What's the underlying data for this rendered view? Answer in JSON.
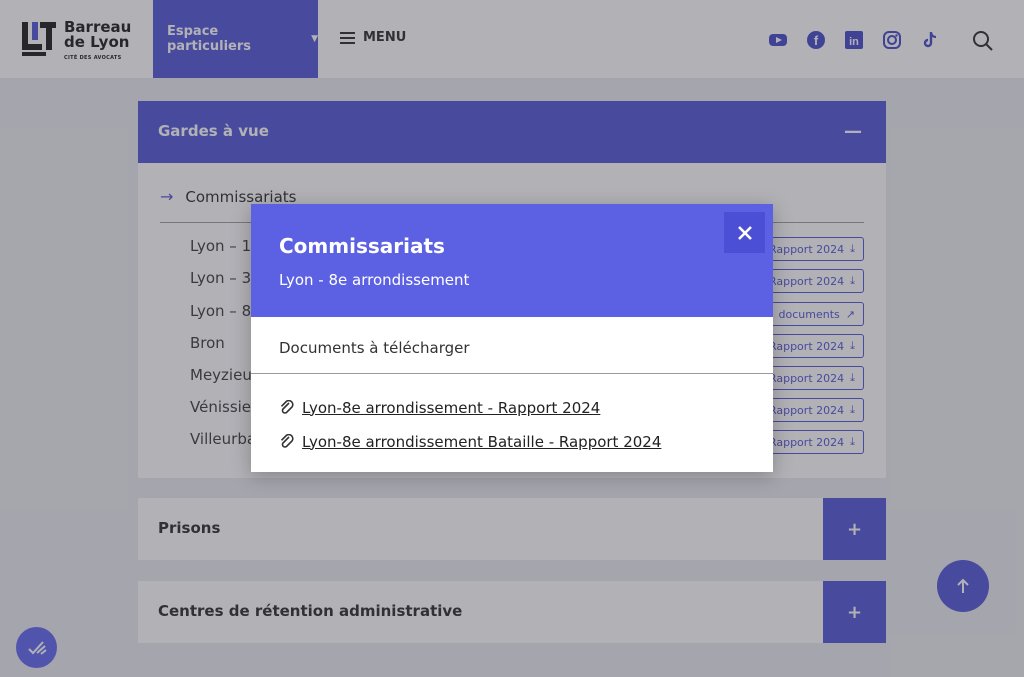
{
  "header": {
    "logo": {
      "line1": "Barreau",
      "line2": "de Lyon",
      "line3": "CITÉ DES AVOCATS"
    },
    "espace_label": "Espace particuliers",
    "menu_label": "MENU",
    "socials": [
      "youtube-icon",
      "facebook-icon",
      "linkedin-icon",
      "instagram-icon",
      "tiktok-icon"
    ]
  },
  "accordion": {
    "open_title": "Gardes à vue",
    "sub_title": "Commissariats",
    "rows": [
      {
        "label": "Lyon – 1er",
        "button": "Rapport 2024",
        "icon": "download-icon"
      },
      {
        "label": "Lyon – 3e",
        "button": "Rapport 2024",
        "icon": "download-icon"
      },
      {
        "label": "Lyon – 8e",
        "button": "documents",
        "icon": "external-link-icon"
      },
      {
        "label": "Bron",
        "button": "Rapport 2024",
        "icon": "download-icon"
      },
      {
        "label": "Meyzieu",
        "button": "Rapport 2024",
        "icon": "download-icon"
      },
      {
        "label": "Vénissieux",
        "button": "Rapport 2024",
        "icon": "download-icon"
      },
      {
        "label": "Villeurbanne",
        "button": "Rapport 2024",
        "icon": "download-icon"
      }
    ],
    "closed": [
      {
        "title": "Prisons"
      },
      {
        "title": "Centres de rétention administrative"
      }
    ]
  },
  "modal": {
    "title": "Commissariats",
    "subtitle": "Lyon - 8e arrondissement",
    "section_title": "Documents à télécharger",
    "documents": [
      "Lyon-8e arrondissement - Rapport 2024",
      "Lyon-8e arrondissement Bataille - Rapport 2024"
    ]
  },
  "colors": {
    "accent": "#4b4fd6",
    "modal_header": "#5c61e4"
  }
}
